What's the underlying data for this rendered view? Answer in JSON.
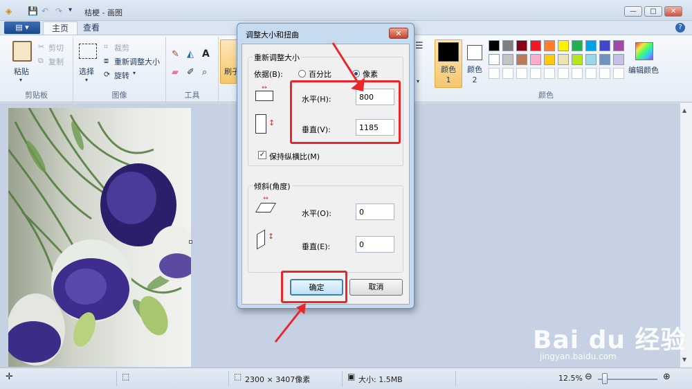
{
  "window": {
    "title": "桔梗 - 画图",
    "quick_access": [
      "💾",
      "↶",
      "↷",
      "▾"
    ],
    "controls": {
      "minimize": "—",
      "maximize": "□",
      "close": "✕"
    }
  },
  "ribbon_tabs": {
    "file": "▤ ▾",
    "home": "主页",
    "view": "查看",
    "help": "?"
  },
  "ribbon": {
    "clipboard": {
      "paste": "粘贴",
      "cut": "剪切",
      "copy": "复制",
      "group": "剪贴板"
    },
    "image": {
      "select": "选择",
      "crop": "裁剪",
      "resize": "重新调整大小",
      "rotate": "旋转",
      "group": "图像"
    },
    "tools": {
      "group": "工具",
      "text_tool": "A"
    },
    "brushes": {
      "label": "刷子"
    },
    "colors": {
      "color1_label": "颜色 1",
      "color2_label": "颜色 2",
      "edit_colors": "编辑颜色",
      "group": "颜色",
      "color1": "#000000",
      "color2": "#ffffff",
      "palette_row1": [
        "#000000",
        "#7f7f7f",
        "#880015",
        "#ed1c24",
        "#ff7f27",
        "#fff200",
        "#22b14c",
        "#00a2e8",
        "#3f48cc",
        "#a349a4"
      ],
      "palette_row2": [
        "#ffffff",
        "#c3c3c3",
        "#b97a57",
        "#ffaec9",
        "#ffc90e",
        "#efe4b0",
        "#b5e61d",
        "#99d9ea",
        "#7092be",
        "#c8bfe7"
      ]
    }
  },
  "dialog": {
    "title": "调整大小和扭曲",
    "close": "✕",
    "resize_section": "重新调整大小",
    "by_label": "依据(B):",
    "percent_label": "百分比",
    "pixels_label": "像素",
    "selected_unit": "pixels",
    "horizontal_label": "水平(H):",
    "horizontal_value": "800",
    "vertical_label": "垂直(V):",
    "vertical_value": "1185",
    "keep_ratio_label": "保持纵横比(M)",
    "keep_ratio_checked": true,
    "skew_section": "倾斜(角度)",
    "skew_horizontal_label": "水平(O):",
    "skew_horizontal_value": "0",
    "skew_vertical_label": "垂直(E):",
    "skew_vertical_value": "0",
    "ok_label": "确定",
    "cancel_label": "取消"
  },
  "status": {
    "dimensions": "2300 × 3407像素",
    "size": "大小: 1.5MB",
    "zoom": "12.5%",
    "zoom_out": "⊖",
    "zoom_in": "⊕"
  },
  "watermark": {
    "brand": "Bai du 经验",
    "url": "jingyan.baidu.com"
  }
}
